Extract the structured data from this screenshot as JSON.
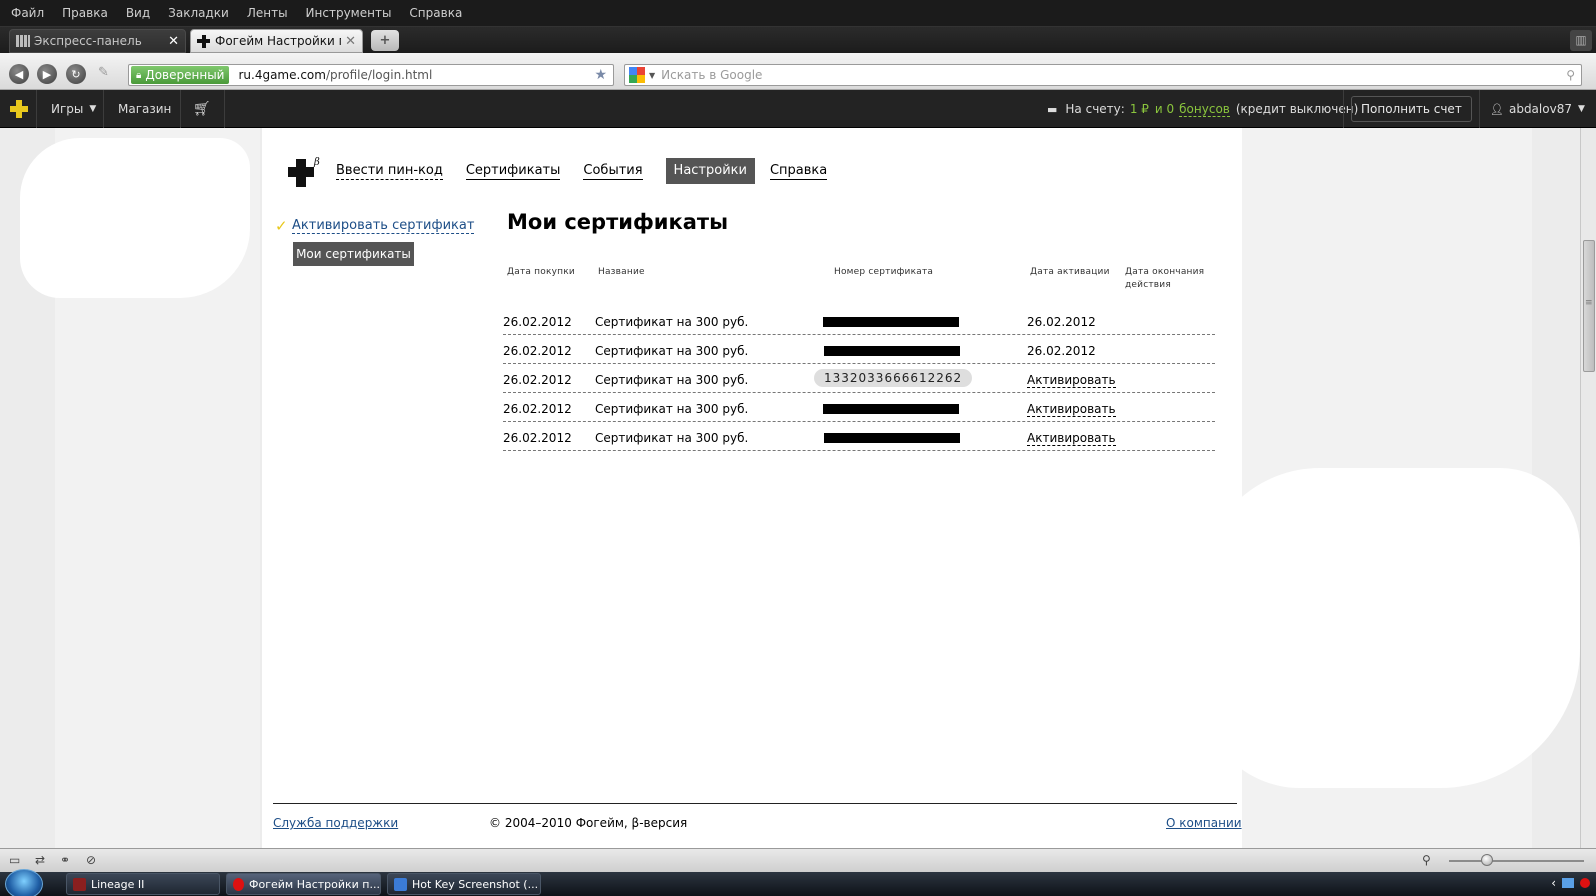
{
  "menubar": {
    "items": [
      "Файл",
      "Правка",
      "Вид",
      "Закладки",
      "Ленты",
      "Инструменты",
      "Справка"
    ]
  },
  "tabs": [
    {
      "label": "Экспресс-панель",
      "close": "✕"
    },
    {
      "label": "Фогейм Настройки п...",
      "close": "✕"
    }
  ],
  "address": {
    "trusted_label": "Доверенный",
    "url_host": "ru.4game.com",
    "url_path": "/profile/login.html",
    "search_placeholder": "Искать в Google"
  },
  "sitebar": {
    "games": "Игры",
    "shop": "Магазин",
    "balance_label": "На счету:",
    "balance_amount": "1 ₽",
    "bonus_and": "и 0",
    "bonus_word": "бонусов",
    "credit": "(кредит выключен)",
    "topup": "Пополнить счет",
    "username": "abdalov87"
  },
  "nav": {
    "pin": "Ввести пин-код",
    "certs": "Сертификаты",
    "events": "События",
    "settings": "Настройки",
    "help": "Справка"
  },
  "sidemenu": {
    "activate": "Активировать сертификат",
    "mine": "Мои сертификаты"
  },
  "page_title": "Мои сертификаты",
  "table": {
    "headers": {
      "purchase_date": "Дата покупки",
      "name": "Название",
      "number": "Номер сертификата",
      "activation_date": "Дата активации",
      "expiry_1": "Дата окончания",
      "expiry_2": "действия"
    },
    "rows": [
      {
        "purchase": "26.02.2012",
        "name": "Сертификат на 300 руб.",
        "number": "",
        "activation": "26.02.2012"
      },
      {
        "purchase": "26.02.2012",
        "name": "Сертификат на 300 руб.",
        "number": "",
        "activation": "26.02.2012"
      },
      {
        "purchase": "26.02.2012",
        "name": "Сертификат на 300 руб.",
        "number": "1332033666612262",
        "activation": "Активировать"
      },
      {
        "purchase": "26.02.2012",
        "name": "Сертификат на 300 руб.",
        "number": "",
        "activation": "Активировать"
      },
      {
        "purchase": "26.02.2012",
        "name": "Сертификат на 300 руб.",
        "number": "",
        "activation": "Активировать"
      }
    ]
  },
  "footer": {
    "support": "Служба поддержки",
    "copyright": "© 2004–2010 Фогейм, β-версия",
    "about": "О компании"
  },
  "taskbar": [
    {
      "label": "Lineage II"
    },
    {
      "label": "Фогейм Настройки п..."
    },
    {
      "label": "Hot Key Screenshot (..."
    }
  ],
  "colors": {
    "accent_yellow": "#e8c81d",
    "accent_green": "#8ac53d",
    "link_blue": "#1d4e87",
    "site_bar": "#232323"
  }
}
